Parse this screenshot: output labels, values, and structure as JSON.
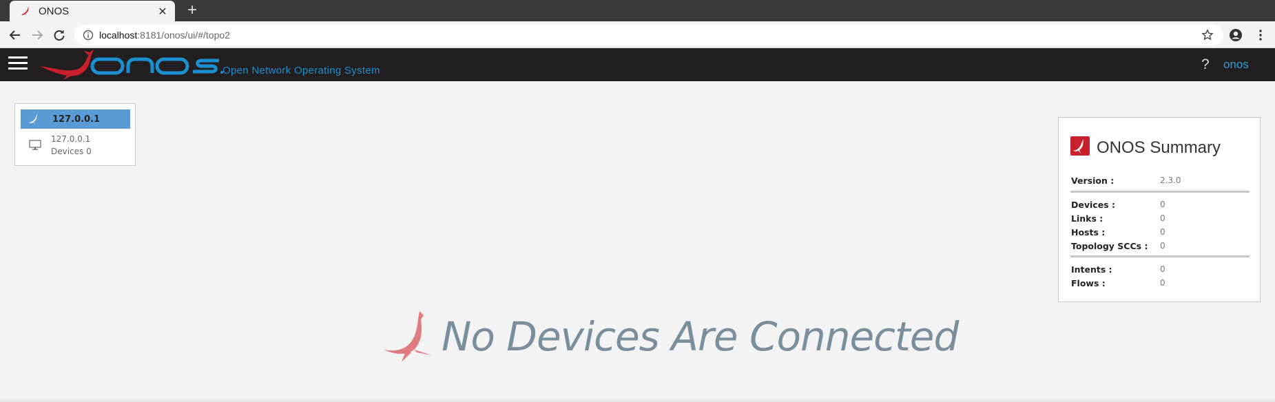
{
  "browser": {
    "tab_title": "ONOS",
    "new_tab_symbol": "+",
    "close_symbol": "✕",
    "url_host": "localhost",
    "url_path": ":8181/onos/ui/#/topo2"
  },
  "masthead": {
    "tagline": "Open Network Operating System",
    "help": "?",
    "user": "onos"
  },
  "cluster": {
    "header_ip": "127.0.0.1",
    "node_ip": "127.0.0.1",
    "devices_label": "Devices 0"
  },
  "summary": {
    "title": "ONOS Summary",
    "version_label": "Version :",
    "version_value": "2.3.0",
    "devices_label": "Devices :",
    "devices_value": "0",
    "links_label": "Links :",
    "links_value": "0",
    "hosts_label": "Hosts :",
    "hosts_value": "0",
    "sccs_label": "Topology SCCs :",
    "sccs_value": "0",
    "intents_label": "Intents :",
    "intents_value": "0",
    "flows_label": "Flows :",
    "flows_value": "0"
  },
  "center": {
    "message": "No Devices Are Connected"
  },
  "colors": {
    "masthead_bg": "#231f20",
    "onos_blue": "#1c8fd0",
    "onos_red": "#c8212d",
    "cluster_header": "#5b9bd5",
    "message_gray": "#7b8e9c"
  },
  "icons": [
    "onos-favicon-icon",
    "back-arrow-icon",
    "forward-arrow-icon",
    "reload-icon",
    "info-icon",
    "star-icon",
    "account-icon",
    "menu-dots-icon",
    "hamburger-icon",
    "onos-logo",
    "onos-bird-icon",
    "monitor-icon"
  ]
}
